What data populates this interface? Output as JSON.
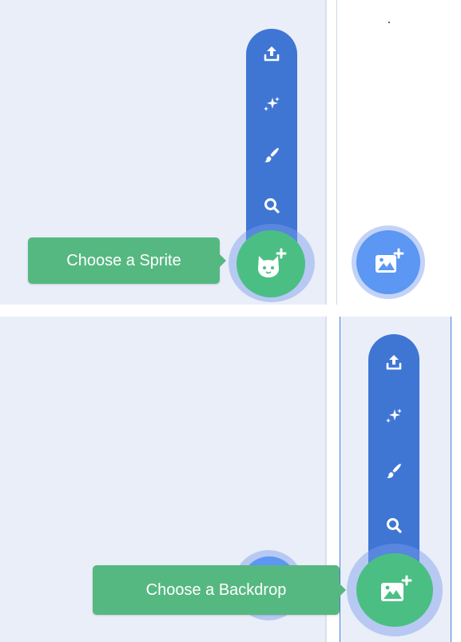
{
  "sprite_menu": {
    "items": [
      {
        "icon": "upload-icon"
      },
      {
        "icon": "surprise-sparkle-icon"
      },
      {
        "icon": "paint-brush-icon"
      },
      {
        "icon": "search-icon"
      }
    ],
    "button_icon": "cat-plus-icon",
    "tooltip": "Choose a Sprite"
  },
  "backdrop_menu": {
    "items": [
      {
        "icon": "upload-icon"
      },
      {
        "icon": "surprise-sparkle-icon"
      },
      {
        "icon": "paint-brush-icon"
      },
      {
        "icon": "search-icon"
      }
    ],
    "button_icon": "image-plus-icon",
    "tooltip": "Choose a Backdrop"
  },
  "colors": {
    "menu_blue": "#3f76d4",
    "fab_green": "#4bbf83",
    "fab_blue": "#5b97f3",
    "tooltip_green": "#56b881",
    "pane_bg": "#e9eef8"
  }
}
